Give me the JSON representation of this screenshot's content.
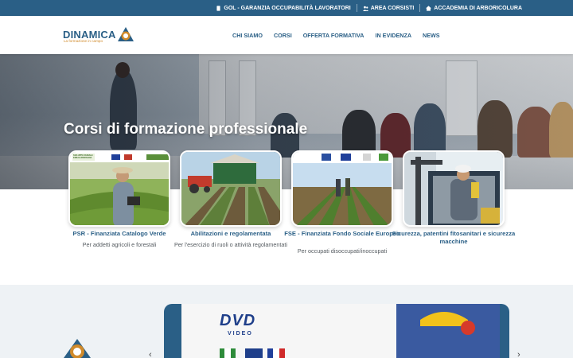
{
  "topbar": {
    "gol": "GOL - GARANZIA OCCUPABILITÀ LAVORATORI",
    "area": "AREA CORSISTI",
    "accademia": "ACCADEMIA DI ARBORICOLURA"
  },
  "logo": {
    "name": "DINAMICA",
    "tagline": "La formazione in campo"
  },
  "nav": [
    "CHI SIAMO",
    "CORSI",
    "OFFERTA FORMATIVA",
    "IN EVIDENZA",
    "NEWS"
  ],
  "hero": {
    "title": "Corsi di formazione professionale"
  },
  "cards": [
    {
      "title": "PSR - Finanziata Catalogo Verde",
      "desc": "Per addetti agricoli e forestali",
      "banner": "SVILUPPO RURALE EMILIA-ROMAGNA"
    },
    {
      "title": "Abilitazioni e regolamentata",
      "desc": "Per l'esercizio di ruoli o attività regolamentati"
    },
    {
      "title": "FSE - Finanziata Fondo Sociale Europeo",
      "desc": "Per occupati disoccupati/inoccupati"
    },
    {
      "title": "Sicurezza, patentini fitosanitari e sicurezza macchine",
      "desc": ""
    }
  ],
  "slider": {
    "dvd_text": "DVD",
    "video_text": "VIDEO"
  },
  "colors": {
    "primary": "#2a5f86",
    "accent": "#d08a2a",
    "band": "#eef2f5"
  }
}
